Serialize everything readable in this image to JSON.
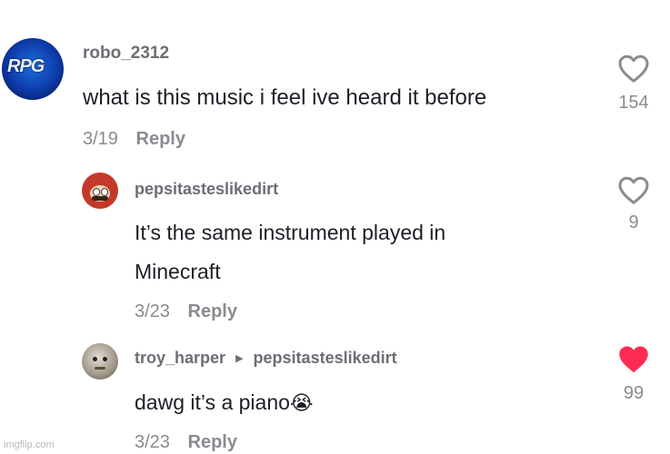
{
  "comments": [
    {
      "avatar_label": "RPG",
      "username": "robo_2312",
      "text": "what is this music i feel ive heard it before",
      "date": "3/19",
      "reply_label": "Reply",
      "likes": "154",
      "liked": false
    },
    {
      "username": "pepsitasteslikedirt",
      "text_lines": [
        "It’s the same instrument played in",
        "Minecraft"
      ],
      "date": "3/23",
      "reply_label": "Reply",
      "likes": "9",
      "liked": false
    },
    {
      "username": "troy_harper",
      "reply_to": "pepsitasteslikedirt",
      "text": "dawg it’s a piano",
      "emoji": "😭",
      "date": "3/23",
      "reply_label": "Reply",
      "likes": "99",
      "liked": true
    }
  ],
  "colors": {
    "heart_liked": "#fe2c55",
    "heart_outline": "#8a8b91"
  },
  "watermark": "imgflip.com"
}
